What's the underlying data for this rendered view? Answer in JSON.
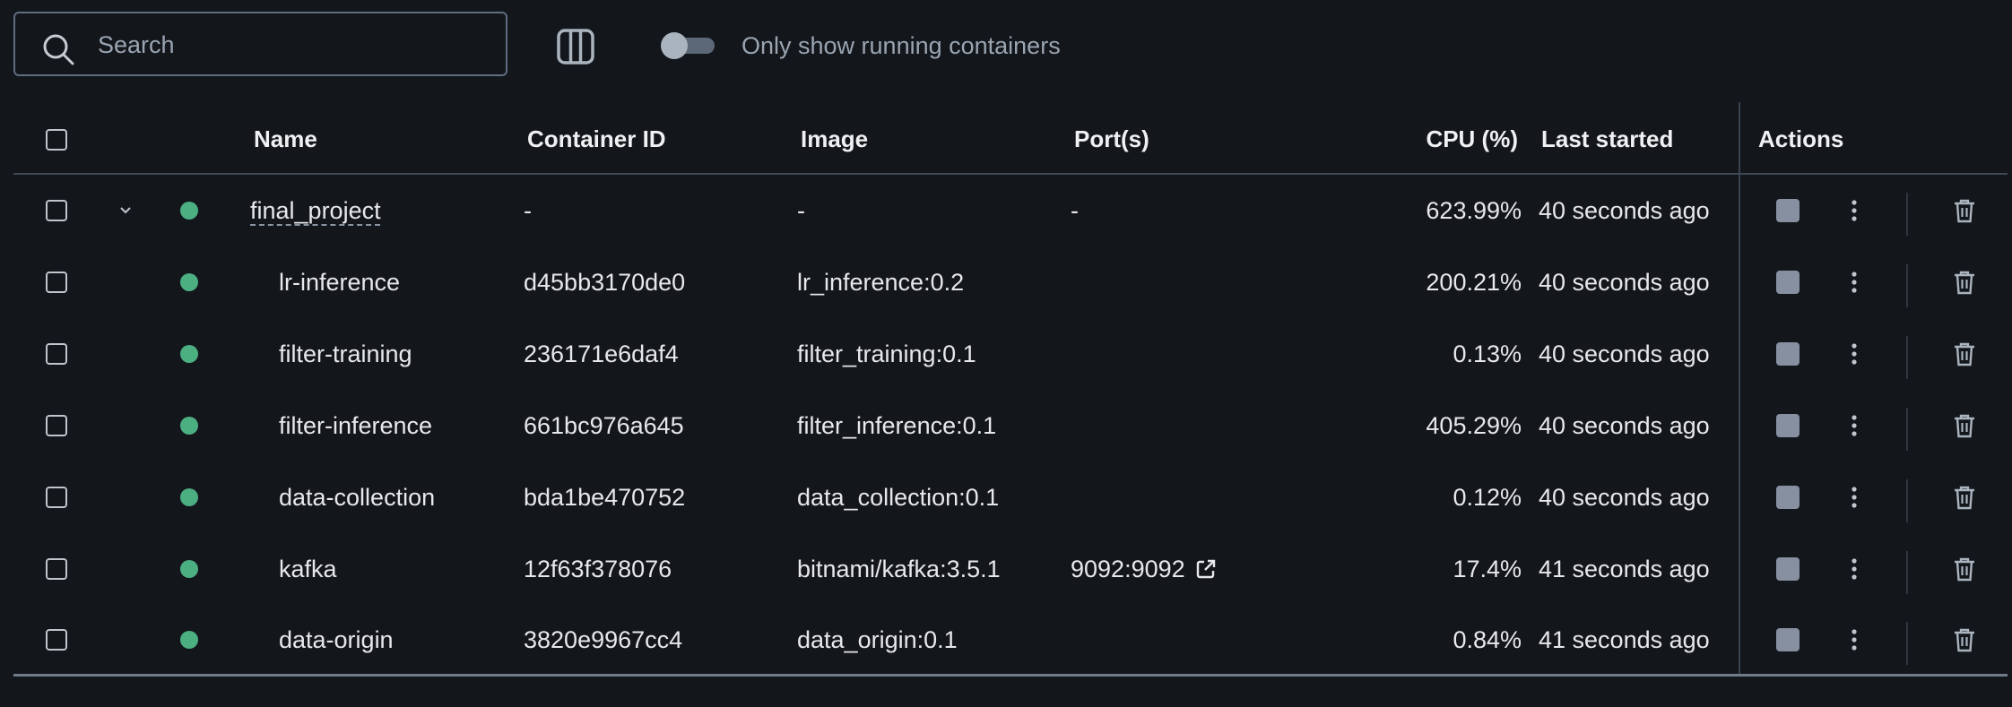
{
  "search": {
    "placeholder": "Search",
    "value": ""
  },
  "toolbar": {
    "toggle_label": "Only show running containers",
    "toggle_on": false
  },
  "table": {
    "headers": {
      "name": "Name",
      "container_id": "Container ID",
      "image": "Image",
      "ports": "Port(s)",
      "cpu": "CPU (%)",
      "last_started": "Last started",
      "actions": "Actions"
    },
    "rows": [
      {
        "name": "final_project",
        "container_id": "-",
        "image": "-",
        "ports": "-",
        "cpu": "623.99%",
        "last_started": "40 seconds ago"
      },
      {
        "name": "lr-inference",
        "container_id": "d45bb3170de0",
        "image": "lr_inference:0.2",
        "ports": "",
        "cpu": "200.21%",
        "last_started": "40 seconds ago"
      },
      {
        "name": "filter-training",
        "container_id": "236171e6daf4",
        "image": "filter_training:0.1",
        "ports": "",
        "cpu": "0.13%",
        "last_started": "40 seconds ago"
      },
      {
        "name": "filter-inference",
        "container_id": "661bc976a645",
        "image": "filter_inference:0.1",
        "ports": "",
        "cpu": "405.29%",
        "last_started": "40 seconds ago"
      },
      {
        "name": "data-collection",
        "container_id": "bda1be470752",
        "image": "data_collection:0.1",
        "ports": "",
        "cpu": "0.12%",
        "last_started": "40 seconds ago"
      },
      {
        "name": "kafka",
        "container_id": "12f63f378076",
        "image": "bitnami/kafka:3.5.1",
        "ports": "9092:9092",
        "cpu": "17.4%",
        "last_started": "41 seconds ago"
      },
      {
        "name": "data-origin",
        "container_id": "3820e9967cc4",
        "image": "data_origin:0.1",
        "ports": "",
        "cpu": "0.84%",
        "last_started": "41 seconds ago"
      }
    ]
  },
  "icons": {
    "search": "search-icon",
    "columns": "columns-icon",
    "expand": "chevron-down-icon",
    "status": "status-running-dot",
    "stop": "stop-icon",
    "more": "more-vertical-icon",
    "delete": "trash-icon",
    "external_link": "external-link-icon"
  },
  "colors": {
    "background": "#13161b",
    "running": "#4caf82",
    "border": "#5f6d7e"
  }
}
